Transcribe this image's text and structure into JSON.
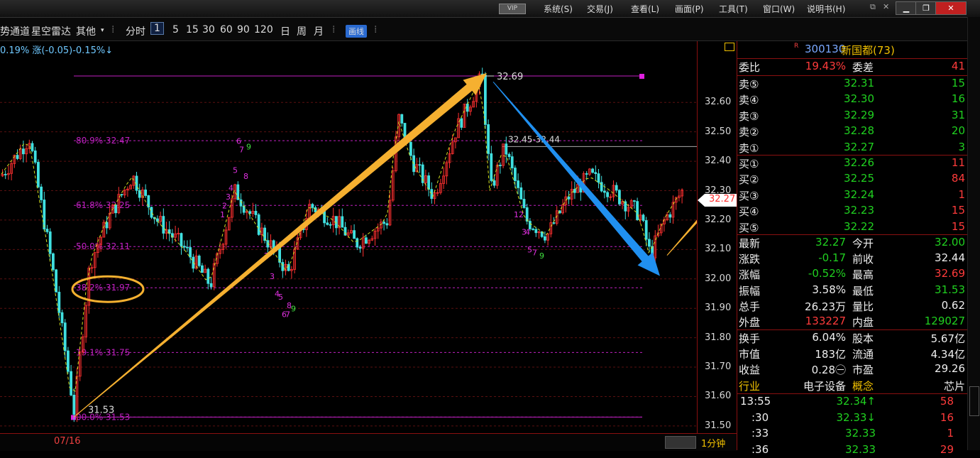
{
  "menu": {
    "vip": "VIP",
    "items": [
      "系统(S)",
      "交易(J)",
      "查看(L)",
      "画面(P)",
      "工具(T)",
      "窗口(W)",
      "说明书(H)"
    ]
  },
  "toolbar": {
    "items": [
      "势通道",
      "星空雷达",
      "其他",
      "分时",
      "1",
      "5",
      "15",
      "30",
      "60",
      "90",
      "120",
      "日",
      "周",
      "月"
    ],
    "draw_label": "画线",
    "selected": "1"
  },
  "chart_info": "0.19% 涨(-0.05)-0.15%↓",
  "chart": {
    "ylim": [
      31.49,
      32.76
    ],
    "yticks": [
      "32.60",
      "32.50",
      "32.40",
      "32.30",
      "32.20",
      "32.10",
      "32.00",
      "31.90",
      "31.80",
      "31.70",
      "31.60",
      "31.50"
    ],
    "last_price_tag": "32.27",
    "high_label": "32.69",
    "low_label": "31.53",
    "range_label": "32.45-32.44",
    "fib_levels": [
      {
        "label": "80.9% 32.47",
        "price": 32.47
      },
      {
        "label": "61.8% 32.25",
        "price": 32.25
      },
      {
        "label": "50.0% 32.11",
        "price": 32.11
      },
      {
        "label": "38.2% 31.97",
        "price": 31.97
      },
      {
        "label": "19.1% 31.75",
        "price": 31.75
      },
      {
        "label": "00.0% 31.53",
        "price": 31.53
      }
    ],
    "date_label": "07/16",
    "timeframe": "1分钟",
    "colors": {
      "up": "#ff3030",
      "down": "#40e0e0",
      "fib": "#c020c0",
      "arrow_up": "#f5b030",
      "arrow_down": "#2090f0"
    }
  },
  "panel": {
    "r_mark": "R",
    "code": "300130",
    "name": "新国都(73)",
    "weibi": {
      "label": "委比",
      "value": "19.43%",
      "label2": "委差",
      "value2": "41"
    },
    "asks": [
      {
        "label": "卖⑤",
        "price": "32.31",
        "vol": "15"
      },
      {
        "label": "卖④",
        "price": "32.30",
        "vol": "16"
      },
      {
        "label": "卖③",
        "price": "32.29",
        "vol": "31"
      },
      {
        "label": "卖②",
        "price": "32.28",
        "vol": "20"
      },
      {
        "label": "卖①",
        "price": "32.27",
        "vol": "3"
      }
    ],
    "bids": [
      {
        "label": "买①",
        "price": "32.26",
        "vol": "11"
      },
      {
        "label": "买②",
        "price": "32.25",
        "vol": "84"
      },
      {
        "label": "买③",
        "price": "32.24",
        "vol": "1"
      },
      {
        "label": "买④",
        "price": "32.23",
        "vol": "15"
      },
      {
        "label": "买⑤",
        "price": "32.22",
        "vol": "15"
      }
    ],
    "stats": [
      {
        "l1": "最新",
        "v1": "32.27",
        "c1": "green",
        "l2": "今开",
        "v2": "32.00",
        "c2": "green"
      },
      {
        "l1": "涨跌",
        "v1": "-0.17",
        "c1": "green",
        "l2": "前收",
        "v2": "32.44",
        "c2": "white"
      },
      {
        "l1": "涨幅",
        "v1": "-0.52%",
        "c1": "green",
        "l2": "最高",
        "v2": "32.69",
        "c2": "red"
      },
      {
        "l1": "振幅",
        "v1": "3.58%",
        "c1": "white",
        "l2": "最低",
        "v2": "31.53",
        "c2": "green"
      },
      {
        "l1": "总手",
        "v1": "26.23万",
        "c1": "white",
        "l2": "量比",
        "v2": "0.62",
        "c2": "white"
      },
      {
        "l1": "外盘",
        "v1": "133227",
        "c1": "red",
        "l2": "内盘",
        "v2": "129027",
        "c2": "green"
      }
    ],
    "stats2": [
      {
        "l1": "换手",
        "v1": "6.04%",
        "l2": "股本",
        "v2": "5.67亿"
      },
      {
        "l1": "市值",
        "v1": "183亿",
        "l2": "流通",
        "v2": "4.34亿"
      },
      {
        "l1": "收益",
        "v1": "0.28㊀",
        "l2": "市盈",
        "v2": "29.26"
      },
      {
        "l1": "行业",
        "v1": "电子设备",
        "l2": "概念",
        "v2": "芯片"
      }
    ],
    "ticks": [
      {
        "time": "13:55",
        "price": "32.34↑",
        "pc": "green",
        "vol": "58"
      },
      {
        "time": ":30",
        "price": "32.33↓",
        "pc": "green",
        "vol": "16"
      },
      {
        "time": ":33",
        "price": "32.33",
        "pc": "green",
        "vol": "1"
      },
      {
        "time": ":36",
        "price": "32.33",
        "pc": "green",
        "vol": "29"
      }
    ]
  }
}
